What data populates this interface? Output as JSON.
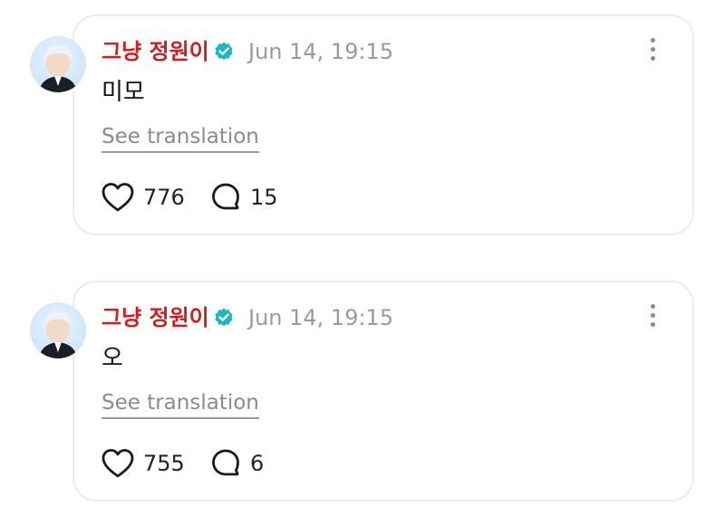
{
  "posts": [
    {
      "author": "그냥 정원이",
      "timestamp": "Jun 14, 19:15",
      "text": "미모",
      "translate_label": "See translation",
      "likes": "776",
      "replies": "15"
    },
    {
      "author": "그냥 정원이",
      "timestamp": "Jun 14, 19:15",
      "text": "오",
      "translate_label": "See translation",
      "likes": "755",
      "replies": "6"
    }
  ],
  "icons": {
    "verified": "verified-badge-icon",
    "more": "more-vertical-icon",
    "like": "heart-icon",
    "reply": "comment-bubble-icon"
  },
  "colors": {
    "author_name": "#d11d1d",
    "verified_badge": "#1fb5c9",
    "timestamp": "#9a9a9a",
    "card_border": "#ececec"
  }
}
